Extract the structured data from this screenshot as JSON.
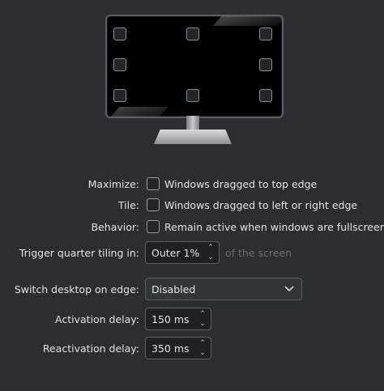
{
  "edge_actions": {
    "buttons": [
      "top-left",
      "top",
      "top-right",
      "left",
      "right",
      "bottom-left",
      "bottom",
      "bottom-right"
    ]
  },
  "maximize": {
    "label": "Maximize:",
    "checkbox_text": "Windows dragged to top edge",
    "checked": false
  },
  "tile": {
    "label": "Tile:",
    "checkbox_text": "Windows dragged to left or right edge",
    "checked": false
  },
  "behavior": {
    "label": "Behavior:",
    "checkbox_text": "Remain active when windows are fullscreen",
    "checked": false
  },
  "quarter_tiling": {
    "label": "Trigger quarter tiling in:",
    "value": "Outer 1%",
    "suffix": "of the screen"
  },
  "switch_desktop": {
    "label": "Switch desktop on edge:",
    "value": "Disabled"
  },
  "activation_delay": {
    "label": "Activation delay:",
    "value": "150 ms"
  },
  "reactivation_delay": {
    "label": "Reactivation delay:",
    "value": "350 ms"
  },
  "icons": {
    "spin_up": "chevron-up-icon",
    "spin_down": "chevron-down-icon",
    "combo": "chevron-down-icon"
  }
}
